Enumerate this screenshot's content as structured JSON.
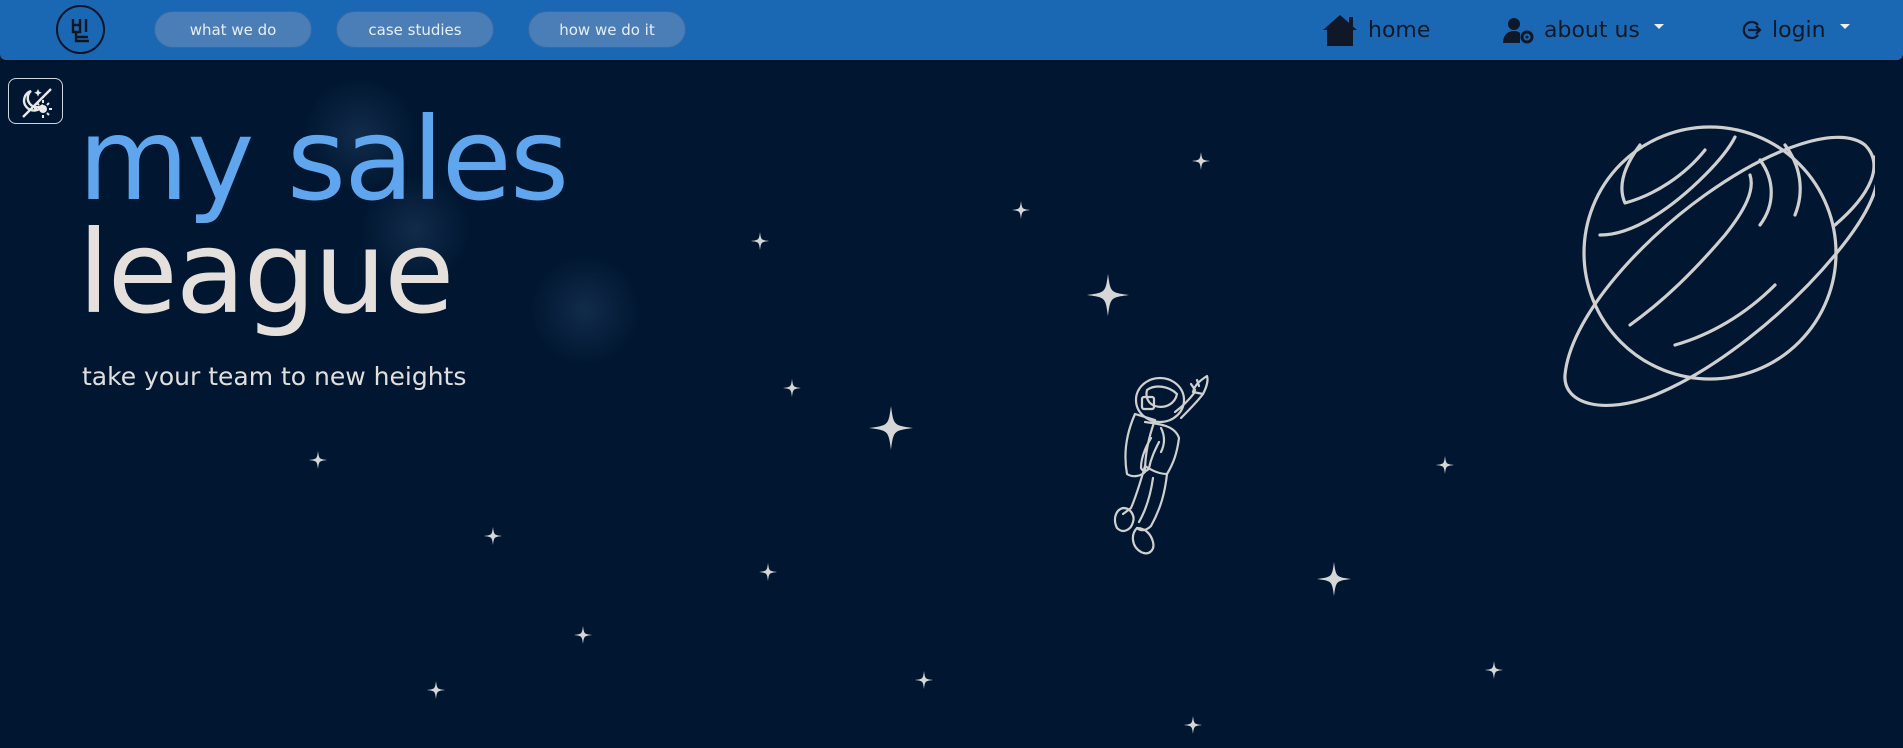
{
  "nav": {
    "logo_letters": "MSL",
    "pills": [
      {
        "label": "what we do"
      },
      {
        "label": "case studies"
      },
      {
        "label": "how we do it"
      }
    ],
    "home_label": "home",
    "about_label": "about us",
    "login_label": "login"
  },
  "hero": {
    "title_line1": "my sales",
    "title_line2": "league",
    "tagline": "take your team to new heights"
  },
  "icons": {
    "home": "home-icon",
    "about": "user-gear-icon",
    "login": "login-icon",
    "theme": "theme-toggle-icon",
    "astronaut": "astronaut-illustration",
    "planet": "planet-illustration",
    "stars": "sparkle-star"
  },
  "colors": {
    "background": "#011731",
    "navbar": "#1A68B4",
    "title_accent": "#60A6EE",
    "title_light": "#E6E0DD",
    "illustration": "#CFCFCF"
  }
}
